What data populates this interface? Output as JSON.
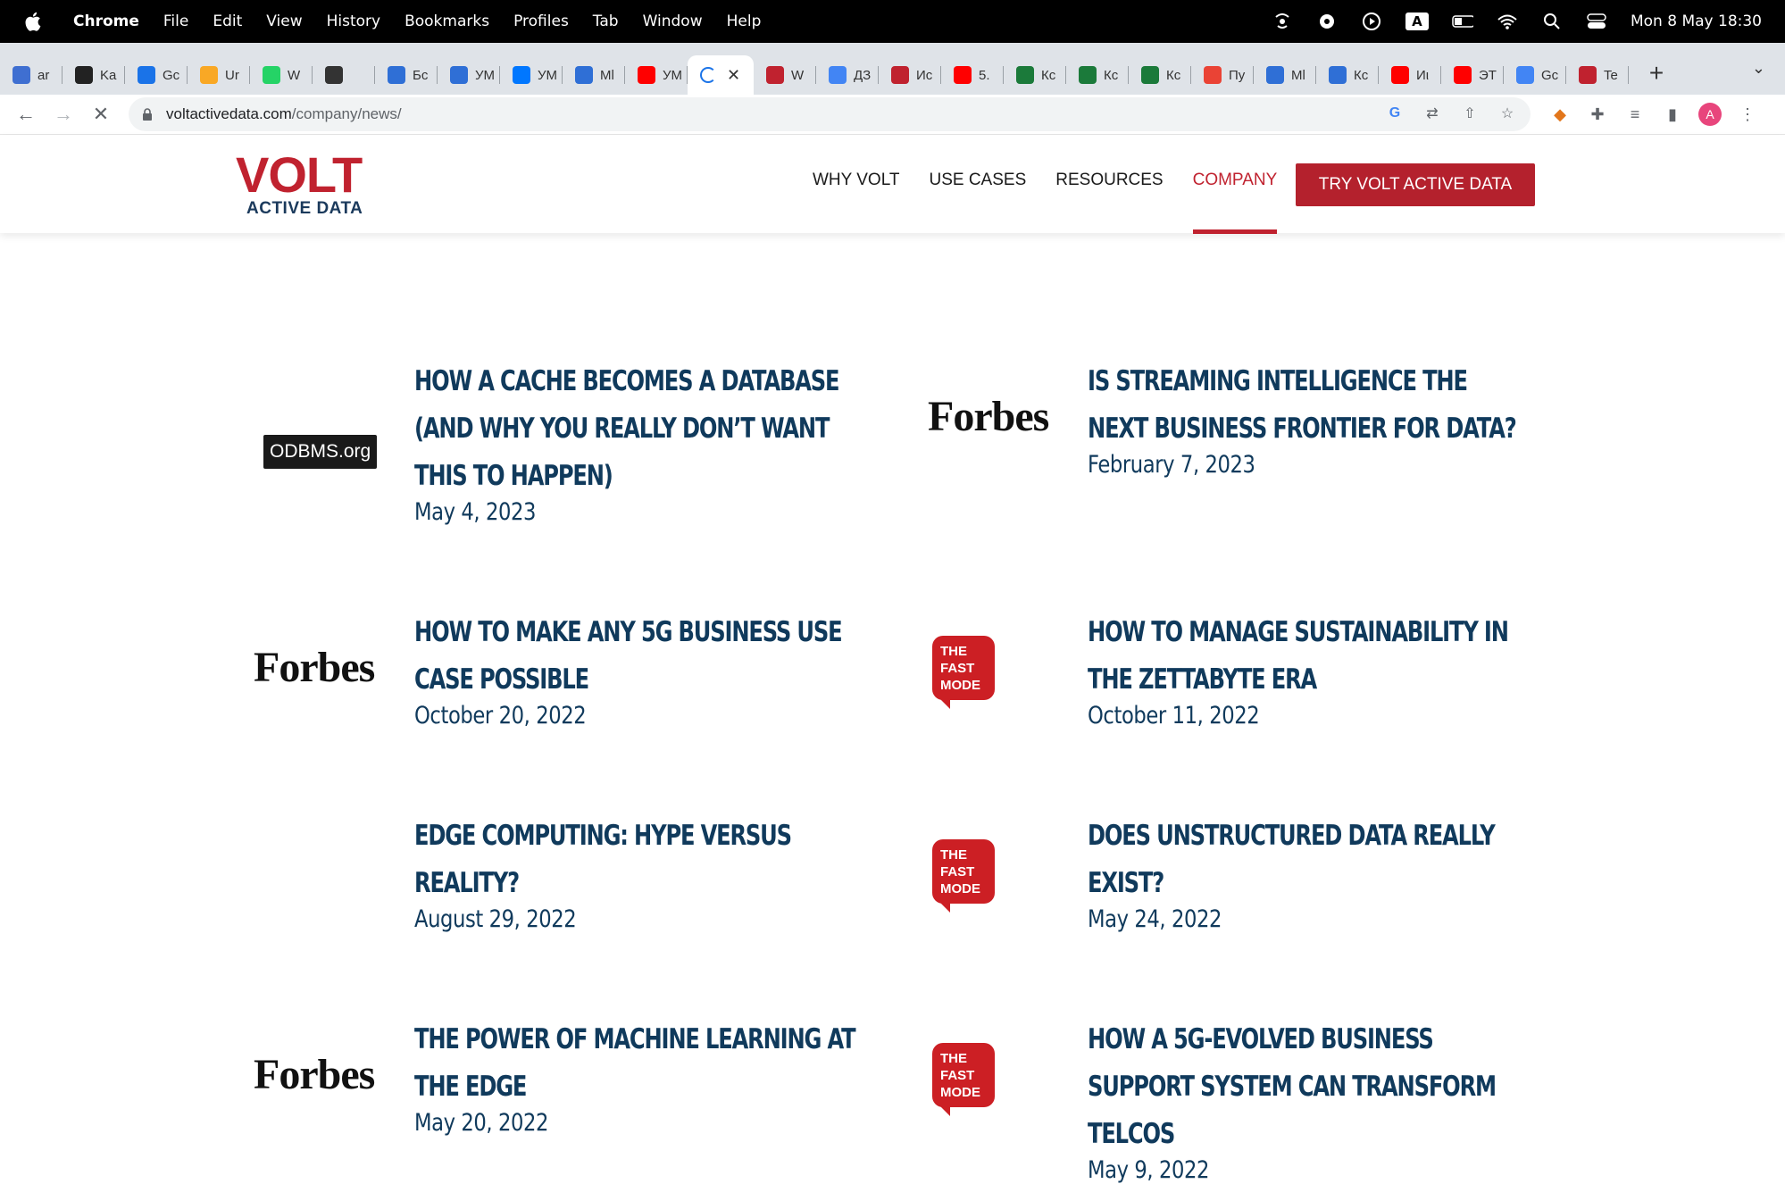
{
  "menubar": {
    "app": "Chrome",
    "items": [
      "File",
      "Edit",
      "View",
      "History",
      "Bookmarks",
      "Profiles",
      "Tab",
      "Window",
      "Help"
    ],
    "input_source": "A",
    "clock": "Mon 8 May  18:30"
  },
  "tabs": [
    {
      "title": "ar",
      "icon": "a-icon",
      "color": "#3f6fd1"
    },
    {
      "title": "Ka",
      "icon": "app-icon",
      "color": "#222222"
    },
    {
      "title": "Gc",
      "icon": "calendar-icon",
      "color": "#1a73e8"
    },
    {
      "title": "Ur",
      "icon": "colab-icon",
      "color": "#f9a825"
    },
    {
      "title": "W",
      "icon": "whatsapp-icon",
      "color": "#25d366"
    },
    {
      "title": "",
      "icon": "play-mute-icon",
      "color": "#333333"
    },
    {
      "title": "Бс",
      "icon": "wave-icon",
      "color": "#2f6fd6"
    },
    {
      "title": "УМ",
      "icon": "wave-icon",
      "color": "#2f6fd6"
    },
    {
      "title": "УМ",
      "icon": "vk-icon",
      "color": "#0077ff"
    },
    {
      "title": "Ml",
      "icon": "wave-icon",
      "color": "#2f6fd6"
    },
    {
      "title": "УМ",
      "icon": "youtube-icon",
      "color": "#ff0000"
    },
    {
      "title": "",
      "icon": "loading-icon",
      "color": "#1a73e8",
      "active": true
    },
    {
      "title": "W",
      "icon": "volt-icon",
      "color": "#c0222f"
    },
    {
      "title": "ДЗ",
      "icon": "docs-icon",
      "color": "#4285f4"
    },
    {
      "title": "Ис",
      "icon": "volt-icon",
      "color": "#c0222f"
    },
    {
      "title": "5.",
      "icon": "youtube-icon",
      "color": "#ff0000"
    },
    {
      "title": "Кс",
      "icon": "runner-icon",
      "color": "#1b7a3a"
    },
    {
      "title": "Кс",
      "icon": "runner-icon",
      "color": "#1b7a3a"
    },
    {
      "title": "Кс",
      "icon": "runner-icon",
      "color": "#1b7a3a"
    },
    {
      "title": "Пу",
      "icon": "maps-pin-icon",
      "color": "#ea4335"
    },
    {
      "title": "Ml",
      "icon": "wave-icon",
      "color": "#2f6fd6"
    },
    {
      "title": "Кс",
      "icon": "wave-icon",
      "color": "#2f6fd6"
    },
    {
      "title": "Иι",
      "icon": "youtube-icon",
      "color": "#ff0000"
    },
    {
      "title": "ЭТ",
      "icon": "youtube-icon",
      "color": "#ff0000"
    },
    {
      "title": "Gc",
      "icon": "translate-icon",
      "color": "#4285f4"
    },
    {
      "title": "Te",
      "icon": "volt-icon",
      "color": "#c0222f"
    }
  ],
  "omnibox": {
    "domain": "voltactivedata.com",
    "path": "/company/news/"
  },
  "profile_initial": "A",
  "site": {
    "logo_main": "VOLT",
    "logo_sub": "ACTIVE DATA",
    "nav": [
      "WHY VOLT",
      "USE CASES",
      "RESOURCES",
      "COMPANY"
    ],
    "cta": "TRY VOLT ACTIVE DATA"
  },
  "articles": [
    {
      "publisher": "ODBMS.org",
      "logo_type": "odbms",
      "headline": "HOW A CACHE BECOMES A DATABASE (AND WHY YOU REALLY DON’T WANT THIS TO HAPPEN)",
      "date": "May 4, 2023"
    },
    {
      "publisher": "Forbes",
      "logo_type": "forbes",
      "headline": "IS STREAMING INTELLIGENCE THE NEXT BUSINESS FRONTIER FOR DATA?",
      "date": "February 7, 2023"
    },
    {
      "publisher": "Forbes",
      "logo_type": "forbes",
      "headline": "HOW TO MAKE ANY 5G BUSINESS USE CASE POSSIBLE",
      "date": "October 20, 2022"
    },
    {
      "publisher": "THE FAST MODE",
      "logo_type": "fastmode",
      "headline": "HOW TO MANAGE SUSTAINABILITY IN THE ZETTABYTE ERA",
      "date": "October 11, 2022"
    },
    {
      "publisher": "",
      "logo_type": "none",
      "headline": "EDGE COMPUTING: HYPE VERSUS REALITY?",
      "date": "August 29, 2022"
    },
    {
      "publisher": "THE FAST MODE",
      "logo_type": "fastmode",
      "headline": "DOES UNSTRUCTURED DATA REALLY EXIST?",
      "date": "May 24, 2022"
    },
    {
      "publisher": "Forbes",
      "logo_type": "forbes",
      "headline": "THE POWER OF MACHINE LEARNING AT THE EDGE",
      "date": "May 20, 2022"
    },
    {
      "publisher": "THE FAST MODE",
      "logo_type": "fastmode",
      "headline": "HOW A 5G-EVOLVED BUSINESS SUPPORT SYSTEM CAN TRANSFORM TELCOS",
      "date": "May 9, 2022"
    }
  ],
  "colors": {
    "brand_red": "#c0222f",
    "headline_navy": "#103a5c"
  }
}
